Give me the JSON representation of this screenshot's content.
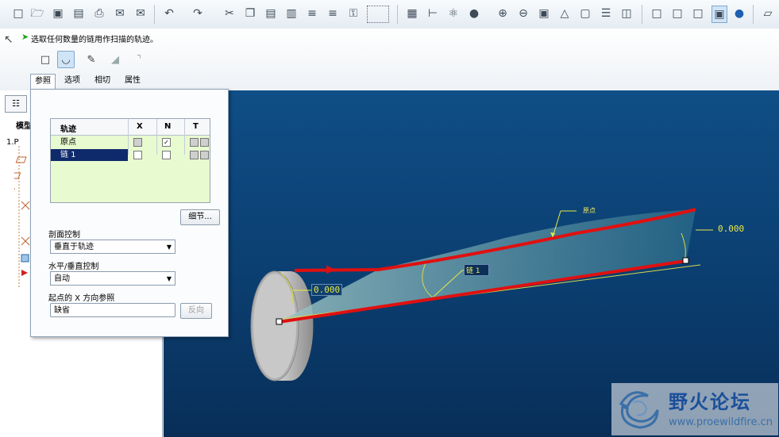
{
  "toolbar": {
    "icons": [
      "new-icon",
      "open-icon",
      "save-icon",
      "save-copy-icon",
      "print-icon",
      "email-icon",
      "email-link-icon",
      "undo-icon",
      "redo-icon",
      "cut-icon",
      "copy-icon",
      "paste-icon",
      "paste-special-icon",
      "regenerate-icon",
      "regenerate-manager-icon",
      "find-icon",
      "select-box-icon",
      "refit-icon",
      "datum-display-icon",
      "spin-center-icon",
      "appearance-icon",
      "zoom-in-icon",
      "zoom-out-icon",
      "zoom-fit-icon",
      "reorient-icon",
      "saved-views-icon",
      "layers-icon",
      "setup-icon",
      "wireframe-icon",
      "hidden-line-icon",
      "no-hidden-icon",
      "shading-icon",
      "enhanced-realism-icon",
      "plane-display-icon"
    ]
  },
  "dashboard": {
    "prompt": "选取任何数量的链用作扫描的轨迹。",
    "modes": [
      "solid-icon",
      "surface-icon",
      "sketch-icon",
      "remove-material-icon",
      "thicken-icon"
    ],
    "tabs": [
      "参照",
      "选项",
      "相切",
      "属性"
    ]
  },
  "model_tree": {
    "header": "模型",
    "root": "1.P"
  },
  "ref_panel": {
    "table_headers": [
      "轨迹",
      "X",
      "N",
      "T"
    ],
    "rows": [
      {
        "name": "原点",
        "x": "grey",
        "n": "checked"
      },
      {
        "name": "链 1",
        "x": "empty",
        "n": "empty"
      }
    ],
    "details_button": "细节...",
    "section_control_label": "剖面控制",
    "section_control_value": "垂直于轨迹",
    "hv_control_label": "水平/垂直控制",
    "hv_control_value": "自动",
    "x_ref_label": "起点的 X 方向参照",
    "x_ref_value": "缺省",
    "flip_button": "反向"
  },
  "viewport": {
    "label_origin": "原点",
    "label_chain": "链 1",
    "dim_left": "0.000",
    "dim_right": "0.000"
  },
  "watermark": {
    "title": "野火论坛",
    "url": "www.proewildfire.cn"
  }
}
